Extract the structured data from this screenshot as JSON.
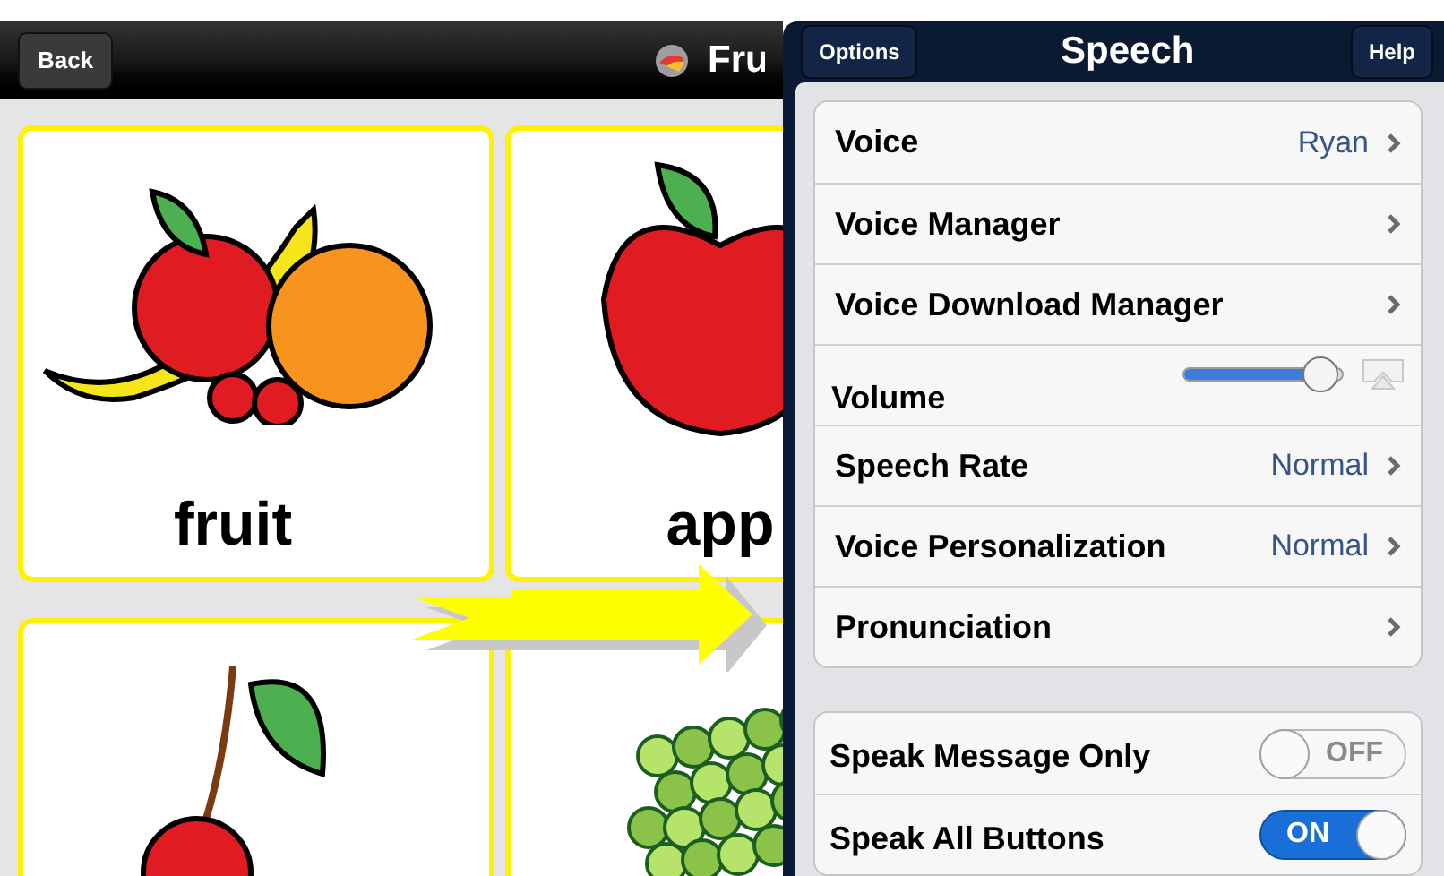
{
  "nav_bar": {
    "back_button": "Back",
    "title": "Fru"
  },
  "cards": [
    {
      "label": "fruit",
      "kind": "fruit"
    },
    {
      "label": "app",
      "kind": "apple"
    },
    {
      "kind": "cherry"
    },
    {
      "kind": "grapes"
    }
  ],
  "speech_popover": {
    "title": "Speech",
    "left_button": "Options",
    "right_button": "Help",
    "groups": [
      [
        {
          "kind": "link",
          "label": "Voice",
          "value": "Ryan"
        },
        {
          "kind": "link",
          "label": "Voice Manager"
        },
        {
          "kind": "link",
          "label": "Voice Download Manager"
        },
        {
          "kind": "slider",
          "label": "Volume",
          "level": 0.85
        },
        {
          "kind": "link",
          "label": "Speech Rate",
          "value": "Normal"
        },
        {
          "kind": "link",
          "label": "Voice Personalization",
          "value": "Normal"
        },
        {
          "kind": "link",
          "label": "Pronunciation"
        }
      ],
      [
        {
          "kind": "toggle",
          "label": "Speak Message Only",
          "on": false,
          "state_text": "OFF"
        },
        {
          "kind": "toggle",
          "label": "Speak All Buttons",
          "on": true,
          "state_text": "ON"
        }
      ]
    ]
  }
}
